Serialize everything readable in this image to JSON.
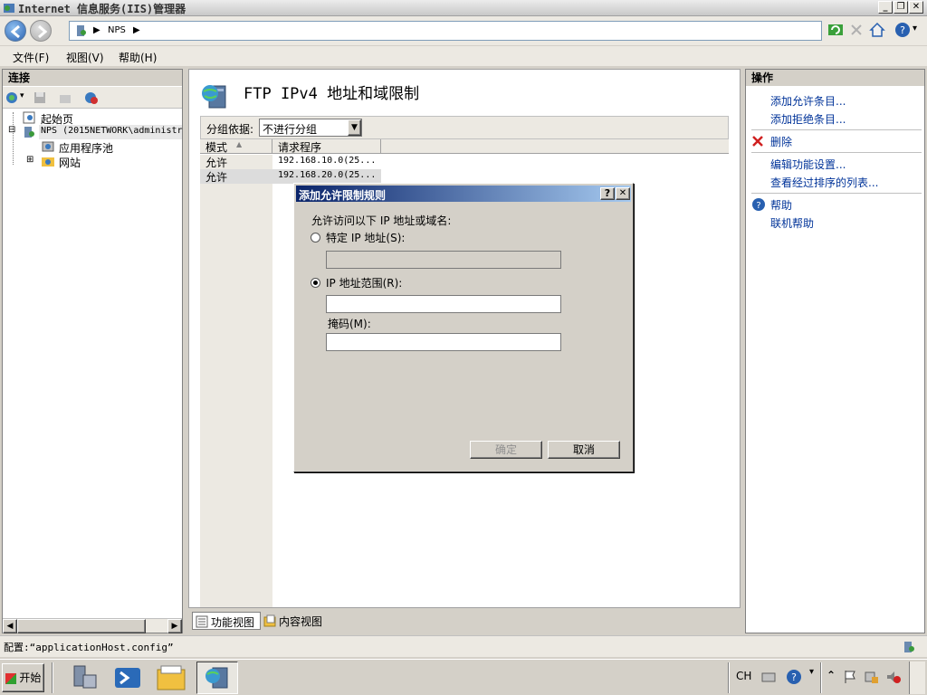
{
  "window": {
    "title": "Internet 信息服务(IIS)管理器"
  },
  "nav": {
    "crumb1": "NPS",
    "sep1": "▶",
    "sep2": "▶"
  },
  "menu": {
    "items": [
      "文件(F)",
      "视图(V)",
      "帮助(H)"
    ]
  },
  "connections": {
    "title": "连接",
    "tree": [
      {
        "label": "起始页",
        "expander": ""
      },
      {
        "label": "NPS (2015NETWORK\\administr",
        "expander": "⊟"
      },
      {
        "label": "应用程序池",
        "expander": ""
      },
      {
        "label": "网站",
        "expander": "⊞"
      }
    ]
  },
  "feature": {
    "title": "FTP IPv4 地址和域限制",
    "group_label": "分组依据:",
    "group_value": "不进行分组",
    "columns": [
      "模式",
      "请求程序"
    ],
    "rows": [
      {
        "mode": "允许",
        "requester": "192.168.10.0(25..."
      },
      {
        "mode": "允许",
        "requester": "192.168.20.0(25..."
      }
    ]
  },
  "bottom_tabs": {
    "feature_view": "功能视图",
    "content_view": "内容视图"
  },
  "actions": {
    "title": "操作",
    "add_allow": "添加允许条目...",
    "add_deny": "添加拒绝条目...",
    "delete": "删除",
    "edit_settings": "编辑功能设置...",
    "view_ordered": "查看经过排序的列表...",
    "help": "帮助",
    "online_help": "联机帮助"
  },
  "dialog": {
    "title": "添加允许限制规则",
    "help_btn": "?",
    "close_btn": "✕",
    "prompt": "允许访问以下 IP 地址或域名:",
    "specific_ip": "特定 IP 地址(S):",
    "ip_range": "IP 地址范围(R):",
    "mask": "掩码(M):",
    "ok": "确定",
    "cancel": "取消",
    "selected_option": "ip_range"
  },
  "status": {
    "text": "配置:“applicationHost.config”"
  },
  "taskbar": {
    "start": "开始",
    "lang": "CH"
  },
  "colors": {
    "accent": "#0a246a",
    "link": "#003399",
    "taskbar": "#d4d0c8"
  }
}
